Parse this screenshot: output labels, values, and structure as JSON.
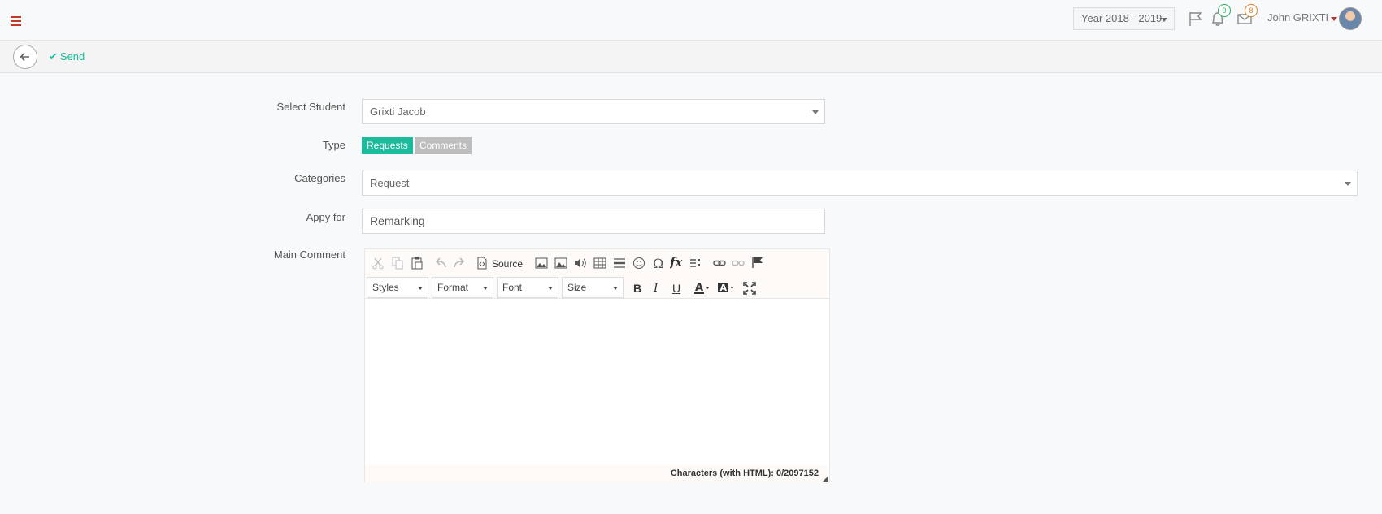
{
  "header": {
    "year": "Year 2018 - 2019",
    "notifications_count": "0",
    "messages_count": "8",
    "user_name": "John GRIXTI"
  },
  "actions": {
    "send_label": "Send"
  },
  "form": {
    "student_label": "Select Student",
    "student_value": "Grixti Jacob",
    "type_label": "Type",
    "type_options": [
      "Requests",
      "Comments"
    ],
    "type_selected": "Requests",
    "categories_label": "Categories",
    "categories_value": "Request",
    "apply_label": "Appy for",
    "apply_value": "Remarking",
    "comment_label": "Main Comment"
  },
  "editor": {
    "source_label": "Source",
    "styles_label": "Styles",
    "format_label": "Format",
    "font_label": "Font",
    "size_label": "Size",
    "bold": "B",
    "italic": "I",
    "underline": "U",
    "char_count": "Characters (with HTML): 0/2097152"
  },
  "colors": {
    "accent": "#1abc9c",
    "inactive": "#bdbdbd",
    "menu_red": "#c0392b"
  }
}
